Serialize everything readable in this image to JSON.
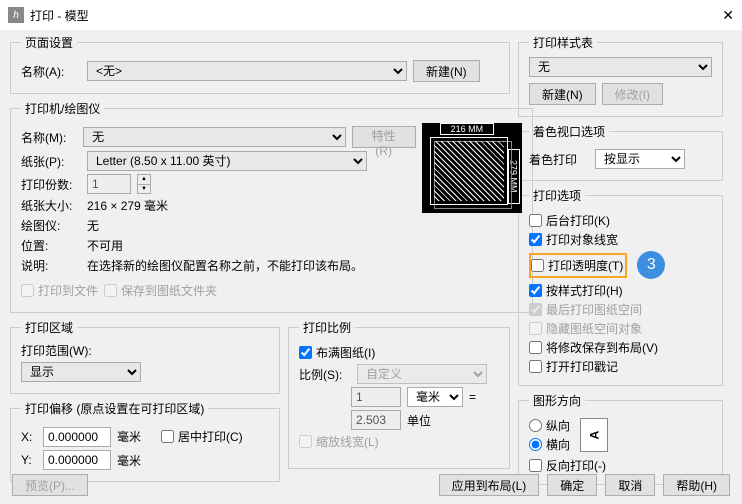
{
  "title": "打印 - 模型",
  "page_setup": {
    "legend": "页面设置",
    "name_label": "名称(A):",
    "name_value": "<无>",
    "new_btn": "新建(N)"
  },
  "printer": {
    "legend": "打印机/绘图仪",
    "name_label": "名称(M):",
    "name_value": "无",
    "props_btn": "特性(R)",
    "paper_label": "纸张(P):",
    "paper_value": "Letter (8.50 x 11.00 英寸)",
    "copies_label": "打印份数:",
    "copies_value": "1",
    "size_label": "纸张大小:",
    "size_value": "216 × 279  毫米",
    "plotter_label": "绘图仪:",
    "plotter_value": "无",
    "location_label": "位置:",
    "location_value": "不可用",
    "desc_label": "说明:",
    "desc_value": "在选择新的绘图仪配置名称之前，不能打印该布局。",
    "to_file": "打印到文件",
    "save_paper": "保存到图纸文件夹",
    "dim_w": "216 MM",
    "dim_h": "279 MM"
  },
  "area": {
    "legend": "打印区域",
    "range_label": "打印范围(W):",
    "range_value": "显示"
  },
  "offset": {
    "legend": "打印偏移 (原点设置在可打印区域)",
    "x_label": "X:",
    "x_value": "0.000000",
    "y_label": "Y:",
    "y_value": "0.000000",
    "unit": "毫米",
    "center": "居中打印(C)"
  },
  "scale": {
    "legend": "打印比例",
    "fit": "布满图纸(I)",
    "ratio_label": "比例(S):",
    "ratio_value": "自定义",
    "num_value": "1",
    "num_unit": "毫米",
    "equals": "=",
    "den_value": "2.503",
    "den_unit": "单位",
    "scale_lw": "缩放线宽(L)"
  },
  "style": {
    "legend": "打印样式表",
    "value": "无",
    "new_btn": "新建(N)",
    "modify_btn": "修改(I)"
  },
  "viewport": {
    "legend": "着色视口选项",
    "label": "着色打印",
    "value": "按显示"
  },
  "options": {
    "legend": "打印选项",
    "bg": "后台打印(K)",
    "lw": "打印对象线宽",
    "trans": "打印透明度(T)",
    "style": "按样式打印(H)",
    "last": "最后打印图纸空间",
    "hide": "隐藏图纸空间对象",
    "save": "将修改保存到布局(V)",
    "stamp": "打开打印戳记",
    "badge": "3"
  },
  "orient": {
    "legend": "图形方向",
    "portrait": "纵向",
    "landscape": "横向",
    "reverse": "反向打印(-)",
    "letter": "A"
  },
  "footer": {
    "preview": "预览(P)...",
    "apply": "应用到布局(L)",
    "ok": "确定",
    "cancel": "取消",
    "help": "帮助(H)"
  }
}
